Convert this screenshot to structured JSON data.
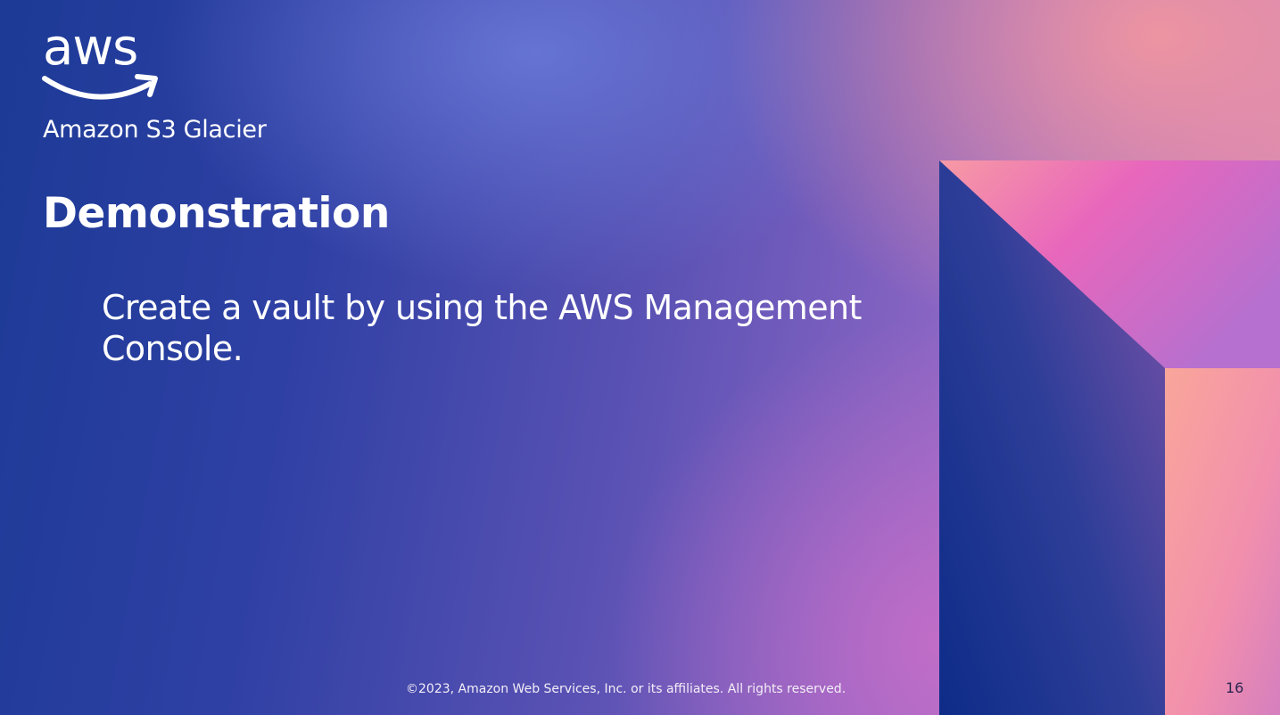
{
  "logo": {
    "text": "aws",
    "icon": "aws-smile-logo"
  },
  "service": {
    "name": "Amazon S3 Glacier"
  },
  "slide": {
    "title": "Demonstration",
    "body": "Create a vault by using the AWS Management Console.",
    "page_number": "16"
  },
  "footer": {
    "copyright": "©2023, Amazon Web Services, Inc. or its affiliates. All rights reserved."
  },
  "colors": {
    "background_left": "#1c3a96",
    "background_right": "#dc8fb0",
    "decor_blue": "#14308f",
    "decor_pink": "#e567b8",
    "decor_peach": "#f7a29a",
    "text": "#ffffff"
  }
}
